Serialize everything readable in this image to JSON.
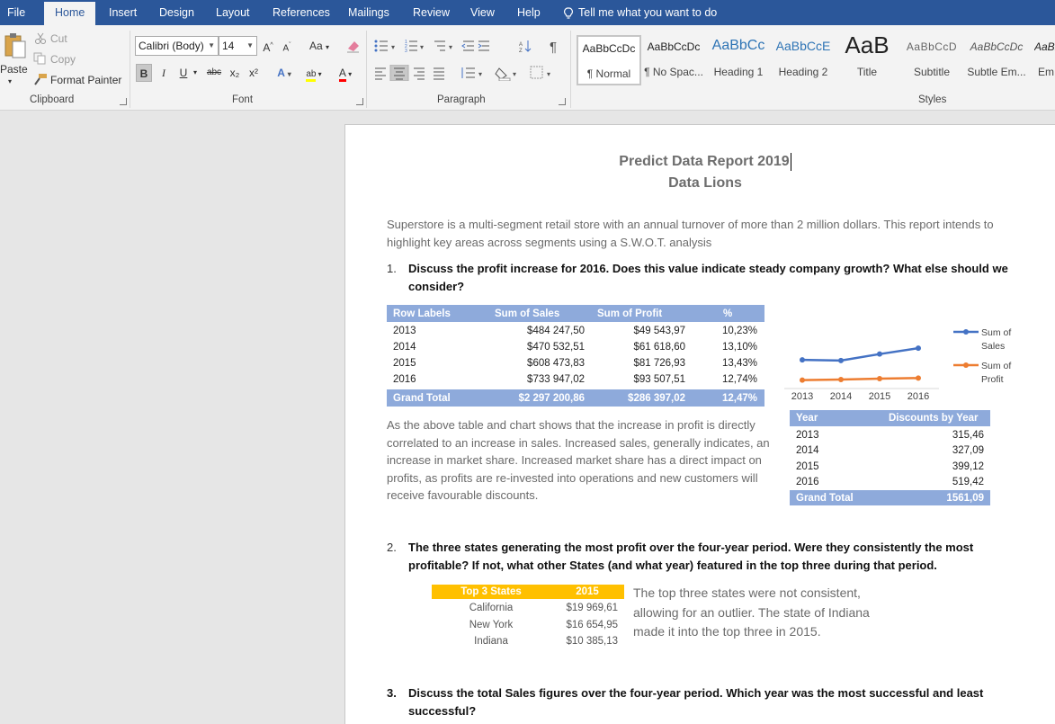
{
  "menubar": {
    "tabs": [
      "File",
      "Home",
      "Insert",
      "Design",
      "Layout",
      "References",
      "Mailings",
      "Review",
      "View",
      "Help"
    ],
    "active_tab": "Home",
    "tell_me": "Tell me what you want to do"
  },
  "ribbon": {
    "clipboard": {
      "paste": "Paste",
      "cut": "Cut",
      "copy": "Copy",
      "format_painter": "Format Painter",
      "label": "Clipboard"
    },
    "font": {
      "font_name": "Calibri (Body)",
      "font_size": "14",
      "change_case": "Aa",
      "bold": "B",
      "italic": "I",
      "underline": "U",
      "strike": "abc",
      "subscript": "x₂",
      "superscript": "x²",
      "label": "Font"
    },
    "paragraph": {
      "label": "Paragraph"
    },
    "styles": {
      "label": "Styles",
      "items": [
        {
          "preview": "AaBbCcDc",
          "name": "¶ Normal"
        },
        {
          "preview": "AaBbCcDc",
          "name": "¶ No Spac..."
        },
        {
          "preview": "AaBbCc",
          "name": "Heading 1"
        },
        {
          "preview": "AaBbCcE",
          "name": "Heading 2"
        },
        {
          "preview": "AaB",
          "name": "Title"
        },
        {
          "preview": "AaBbCcD",
          "name": "Subtitle"
        },
        {
          "preview": "AaBbCcDc",
          "name": "Subtle Em..."
        },
        {
          "preview": "AaBb",
          "name": "Em"
        }
      ]
    }
  },
  "document": {
    "title": "Predict Data Report 2019",
    "subtitle": "Data Lions",
    "intro": "Superstore is a multi-segment retail store with an annual turnover of more than 2 million dollars. This report intends to highlight key areas across segments using a S.W.O.T. analysis",
    "q1": {
      "num": "1.",
      "text": "Discuss the profit increase for 2016. Does this value indicate steady company growth? What else should we consider?"
    },
    "table1": {
      "headers": [
        "Row Labels",
        "Sum of Sales",
        "Sum of Profit",
        "%"
      ],
      "rows": [
        [
          "2013",
          "$484 247,50",
          "$49 543,97",
          "10,23%"
        ],
        [
          "2014",
          "$470 532,51",
          "$61 618,60",
          "13,10%"
        ],
        [
          "2015",
          "$608 473,83",
          "$81 726,93",
          "13,43%"
        ],
        [
          "2016",
          "$733 947,02",
          "$93 507,51",
          "12,74%"
        ]
      ],
      "total": [
        "Grand Total",
        "$2 297 200,86",
        "$286 397,02",
        "12,47%"
      ]
    },
    "answer1": "As the above table and chart shows that the increase in profit is directly correlated to an increase in sales. Increased sales, generally indicates, an increase in market share. Increased market share has a direct impact on profits, as profits are re-invested into operations and new customers will receive favourable discounts.",
    "table2": {
      "headers": [
        "Year",
        "Discounts by Year"
      ],
      "rows": [
        [
          "2013",
          "315,46"
        ],
        [
          "2014",
          "327,09"
        ],
        [
          "2015",
          "399,12"
        ],
        [
          "2016",
          "519,42"
        ]
      ],
      "total": [
        "Grand Total",
        "1561,09"
      ]
    },
    "q2": {
      "num": "2.",
      "text": "The three states generating the most profit over the four-year period. Were they consistently the most profitable? If not, what other States (and what year) featured in the top three during that period."
    },
    "table3": {
      "headers": [
        "Top 3 States",
        "2015"
      ],
      "rows": [
        [
          "California",
          "$19 969,61"
        ],
        [
          "New York",
          "$16 654,95"
        ],
        [
          "Indiana",
          "$10 385,13"
        ]
      ],
      "header_color": "#ffc000"
    },
    "answer2": "The top three states were not consistent, allowing for an outlier. The state of Indiana made it into the top three in 2015.",
    "q3": {
      "num": "3.",
      "text": "Discuss the total Sales figures over the four-year period. Which year was the most successful and least successful?"
    }
  },
  "chart_data": {
    "type": "line",
    "categories": [
      "2013",
      "2014",
      "2015",
      "2016"
    ],
    "series": [
      {
        "name": "Sum of Sales",
        "values": [
          484247.5,
          470532.51,
          608473.83,
          733947.02
        ],
        "color": "#4472c4"
      },
      {
        "name": "Sum of Profit",
        "values": [
          49543.97,
          61618.6,
          81726.93,
          93507.51
        ],
        "color": "#ed7d31"
      }
    ],
    "legend_position": "right",
    "ylim": [
      -150000,
      1200000
    ],
    "grid": false
  },
  "colors": {
    "accent": "#2b579a",
    "table_header": "#8eaadb",
    "table3_header": "#ffc000"
  }
}
